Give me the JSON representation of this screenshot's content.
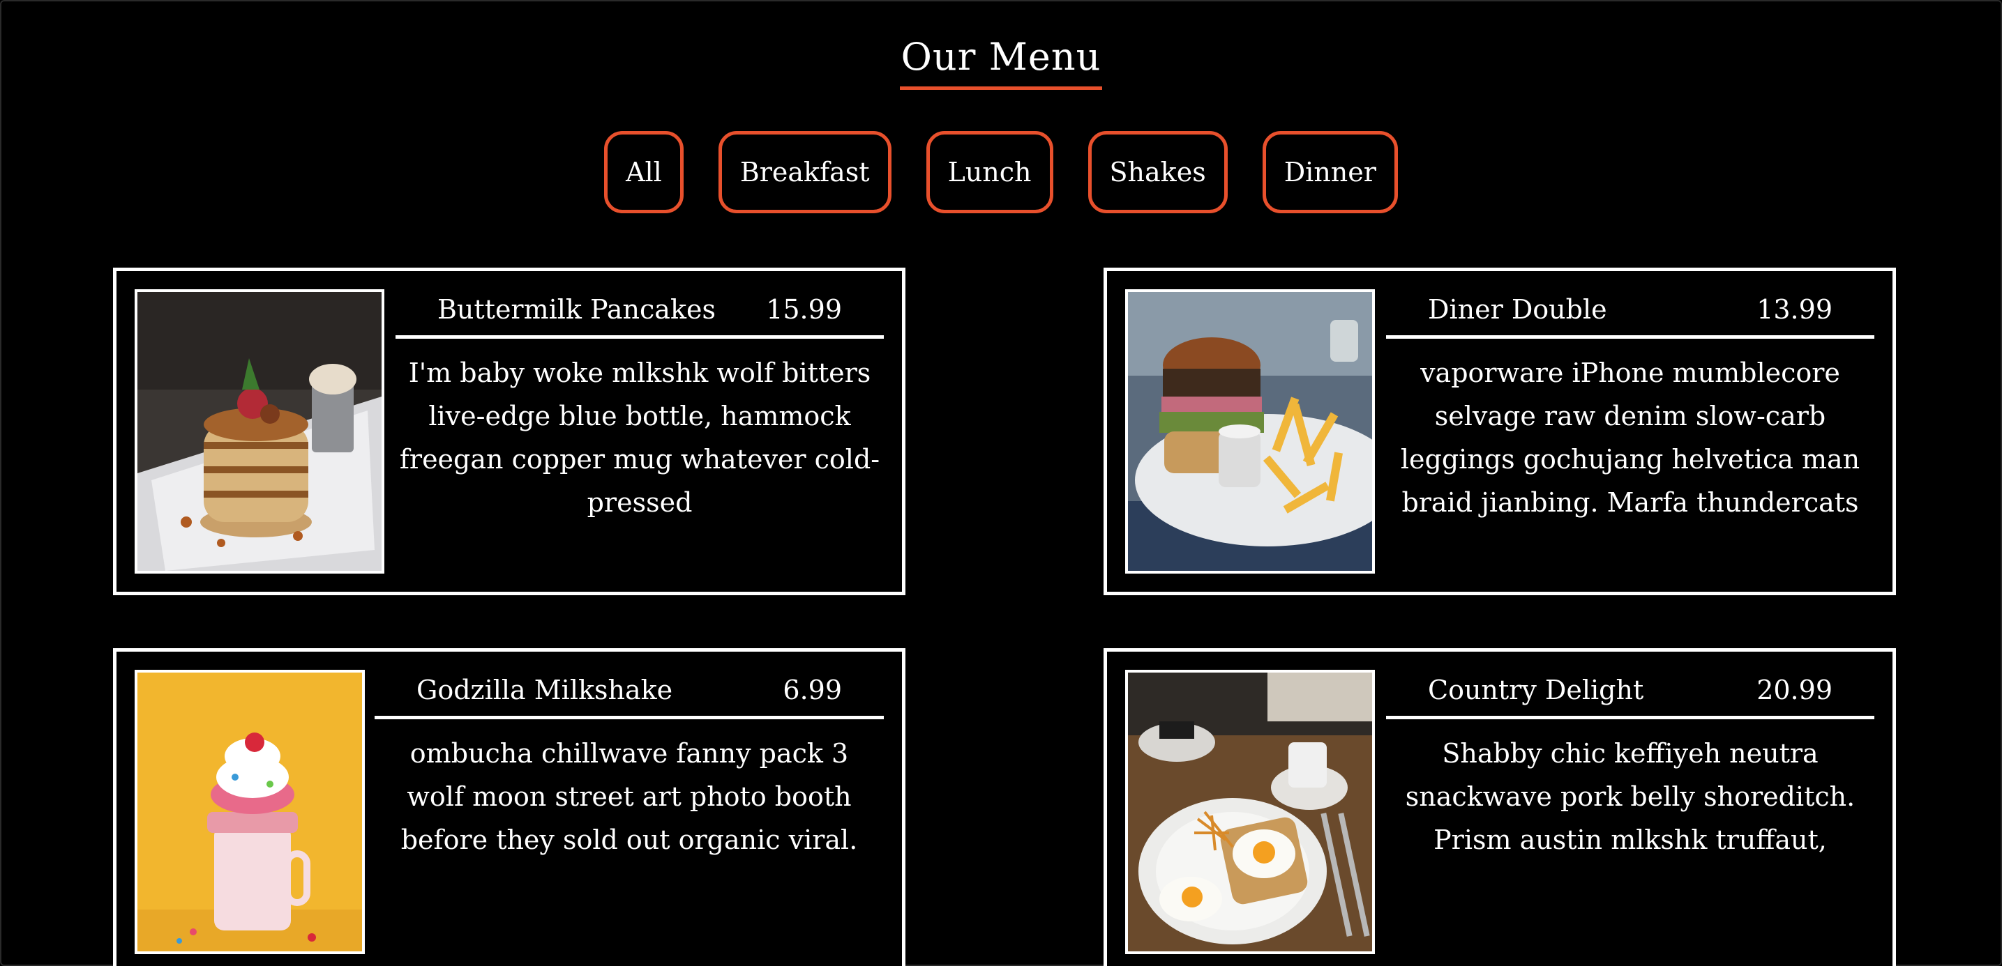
{
  "header": {
    "title": "Our Menu"
  },
  "filters": [
    {
      "label": "All"
    },
    {
      "label": "Breakfast"
    },
    {
      "label": "Lunch"
    },
    {
      "label": "Shakes"
    },
    {
      "label": "Dinner"
    }
  ],
  "colors": {
    "accent": "#e8502c",
    "background": "#000000",
    "text": "#ffffff"
  },
  "menu": [
    {
      "name": "Buttermilk Pancakes",
      "price": "15.99",
      "description": "I'm baby woke mlkshk wolf bitters live-edge blue bottle, hammock freegan copper mug whatever cold-pressed",
      "image": "pancakes-photo"
    },
    {
      "name": "Diner Double",
      "price": "13.99",
      "description": "vaporware iPhone mumblecore selvage raw denim slow-carb leggings gochujang helvetica man braid jianbing. Marfa thundercats",
      "image": "burger-photo"
    },
    {
      "name": "Godzilla Milkshake",
      "price": "6.99",
      "description": "ombucha chillwave fanny pack 3 wolf moon street art photo booth before they sold out organic viral.",
      "image": "milkshake-photo"
    },
    {
      "name": "Country Delight",
      "price": "20.99",
      "description": "Shabby chic keffiyeh neutra snackwave pork belly shoreditch. Prism austin mlkshk truffaut,",
      "image": "breakfast-plate-photo"
    }
  ]
}
